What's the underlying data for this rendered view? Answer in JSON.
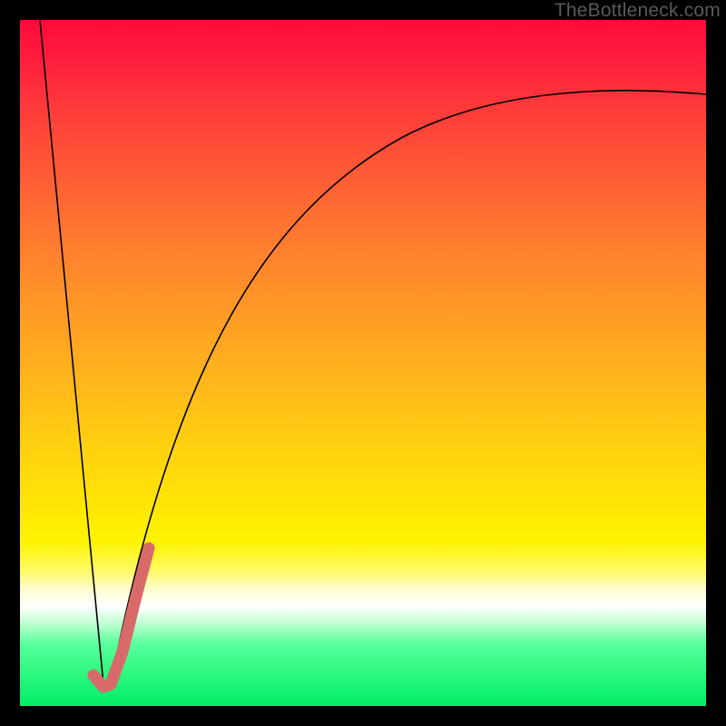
{
  "watermark": "TheBottleneck.com",
  "chart_data": {
    "type": "line",
    "title": "",
    "xlabel": "",
    "ylabel": "",
    "xlim": [
      0,
      100
    ],
    "ylim": [
      0,
      100
    ],
    "grid": false,
    "legend": false,
    "background_gradient": {
      "top": "#ff0a3a",
      "bottom": "#00ee64",
      "stops": [
        "red",
        "orange",
        "yellow",
        "white",
        "green"
      ]
    },
    "series": [
      {
        "name": "left-branch",
        "color": "#000000",
        "stroke_width": 1.5,
        "x": [
          3,
          12
        ],
        "values": [
          100,
          3
        ]
      },
      {
        "name": "right-branch",
        "color": "#000000",
        "stroke_width": 1.5,
        "x": [
          13,
          15,
          18,
          22,
          27,
          33,
          40,
          48,
          57,
          67,
          78,
          89,
          100
        ],
        "values": [
          3,
          12,
          24,
          37,
          50,
          60,
          68,
          74,
          79,
          83,
          85.5,
          87.5,
          89
        ]
      },
      {
        "name": "pink-marker",
        "color": "#d86a6a",
        "stroke_width": 13,
        "x": [
          10.7,
          12.0,
          13.3,
          15.0,
          17.0,
          18.8
        ],
        "values": [
          4.5,
          2.7,
          3.2,
          8.0,
          16.0,
          23.0
        ]
      }
    ]
  }
}
